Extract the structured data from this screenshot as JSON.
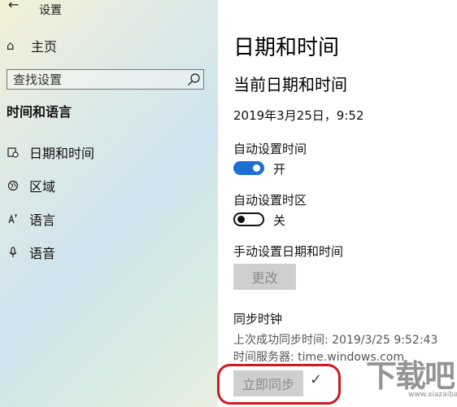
{
  "window": {
    "back_icon": "back-arrow-icon",
    "title": "设置"
  },
  "sidebar": {
    "home": {
      "icon": "home-icon",
      "label": "主页"
    },
    "search": {
      "placeholder": "查找设置",
      "icon": "search-icon"
    },
    "section_title": "时间和语言",
    "items": [
      {
        "icon": "calendar-clock-icon",
        "label": "日期和时间"
      },
      {
        "icon": "region-icon",
        "label": "区域"
      },
      {
        "icon": "language-icon",
        "label": "语言"
      },
      {
        "icon": "microphone-icon",
        "label": "语音"
      }
    ]
  },
  "main": {
    "page_title": "日期和时间",
    "current_section": "当前日期和时间",
    "current_datetime": "2019年3月25日，9:52",
    "auto_time": {
      "label": "自动设置时间",
      "state": "on",
      "state_text": "开"
    },
    "auto_timezone": {
      "label": "自动设置时区",
      "state": "off",
      "state_text": "关"
    },
    "manual": {
      "label": "手动设置日期和时间",
      "button": "更改"
    },
    "sync": {
      "title": "同步时钟",
      "last_sync": "上次成功同步时间: 2019/3/25 9:52:43",
      "server": "时间服务器: time.windows.com",
      "button": "立即同步",
      "status_icon": "checkmark-icon"
    }
  },
  "colors": {
    "accent": "#1e6fd0",
    "highlight_ring": "#d0191f"
  },
  "watermark": {
    "text": "下载吧",
    "sub": "www.xiazaiba.com"
  }
}
